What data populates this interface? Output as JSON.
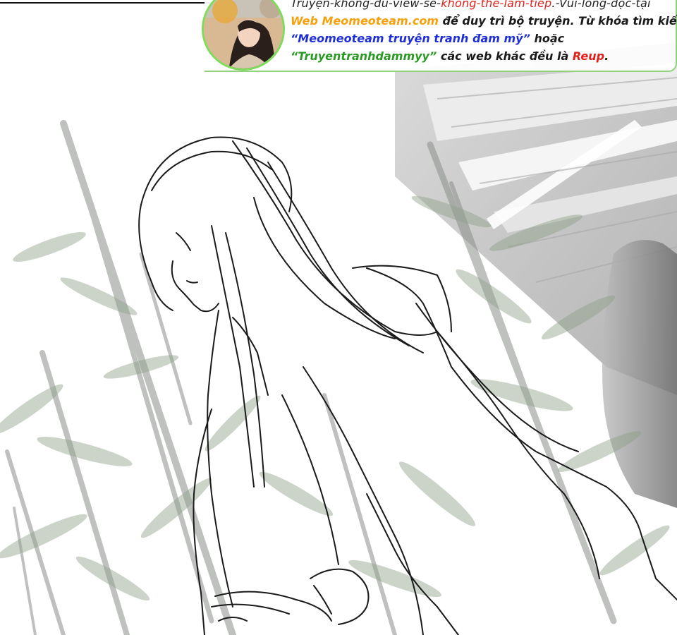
{
  "banner": {
    "line1": {
      "part1": "Truyện-không-đủ-view-sẽ-",
      "part2": "không-thể-làm-tiếp",
      "part3": ".-Vui-lòng-đọc-tại"
    },
    "line2": {
      "site": "Web Meomeoteam.com",
      "rest": " để duy trì bộ truyện. Từ khóa tìm kiếm"
    },
    "line3": {
      "keyword": "“Meomeoteam truyện tranh đam mỹ”",
      "rest": " hoặc"
    },
    "line4": {
      "keyword": "“Truyentranhdammyy”",
      "rest": " các web khác đều là ",
      "reup": "Reup",
      "end": "."
    }
  },
  "colors": {
    "warning_red": "#e0211b",
    "site_orange": "#f4a10f",
    "keyword_blue": "#1f2fd6",
    "keyword_green": "#2a9a24",
    "avatar_ring": "#7fdc5a"
  }
}
